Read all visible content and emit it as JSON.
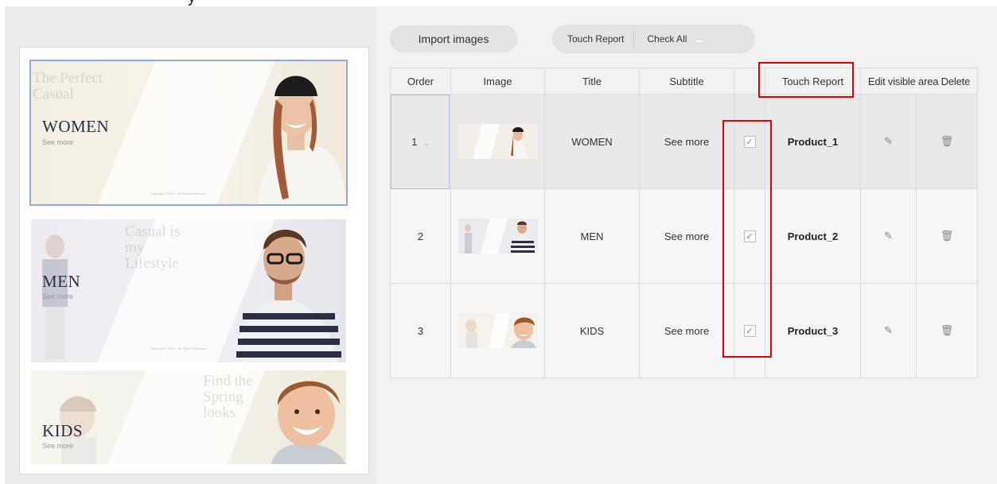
{
  "toolbar": {
    "import_label": "Import images",
    "touch_report_label": "Touch Report",
    "check_all_label": "Check All"
  },
  "table": {
    "headers": {
      "order": "Order",
      "image": "Image",
      "title": "Title",
      "subtitle": "Subtitle",
      "touch_report": "Touch Report",
      "edit_delete": "Edit visible area Delete"
    },
    "rows": [
      {
        "order": "1",
        "title": "WOMEN",
        "subtitle": "See more",
        "checked": true,
        "touch_report": "Product_1"
      },
      {
        "order": "2",
        "title": "MEN",
        "subtitle": "See more",
        "checked": true,
        "touch_report": "Product_2"
      },
      {
        "order": "3",
        "title": "KIDS",
        "subtitle": "See more",
        "checked": true,
        "touch_report": "Product_3"
      }
    ]
  },
  "preview": {
    "banners": [
      {
        "title": "WOMEN",
        "subtitle": "See more",
        "ghost": "The Perfect Casual",
        "fine_print": "Copyright © 2017 · All Rights Reserved",
        "bg": "#f6f1e6"
      },
      {
        "title": "MEN",
        "subtitle": "See more",
        "ghost": "Casual is my Lifestyle",
        "fine_print": "Copyright © 2017 · All Rights Reserved",
        "bg": "#eceaf0"
      },
      {
        "title": "KIDS",
        "subtitle": "See more",
        "ghost": "Find the Spring looks",
        "fine_print": "",
        "bg": "#f4f2e9"
      }
    ]
  },
  "colors": {
    "highlight_red": "#e00000",
    "selection_blue": "#8fa9dc",
    "panel_gray": "#f2f2f2"
  },
  "icons": {
    "checkbox": "check-icon",
    "edit": "pencil-icon",
    "delete": "trash-icon",
    "dropdown": "chevron-down-icon"
  }
}
